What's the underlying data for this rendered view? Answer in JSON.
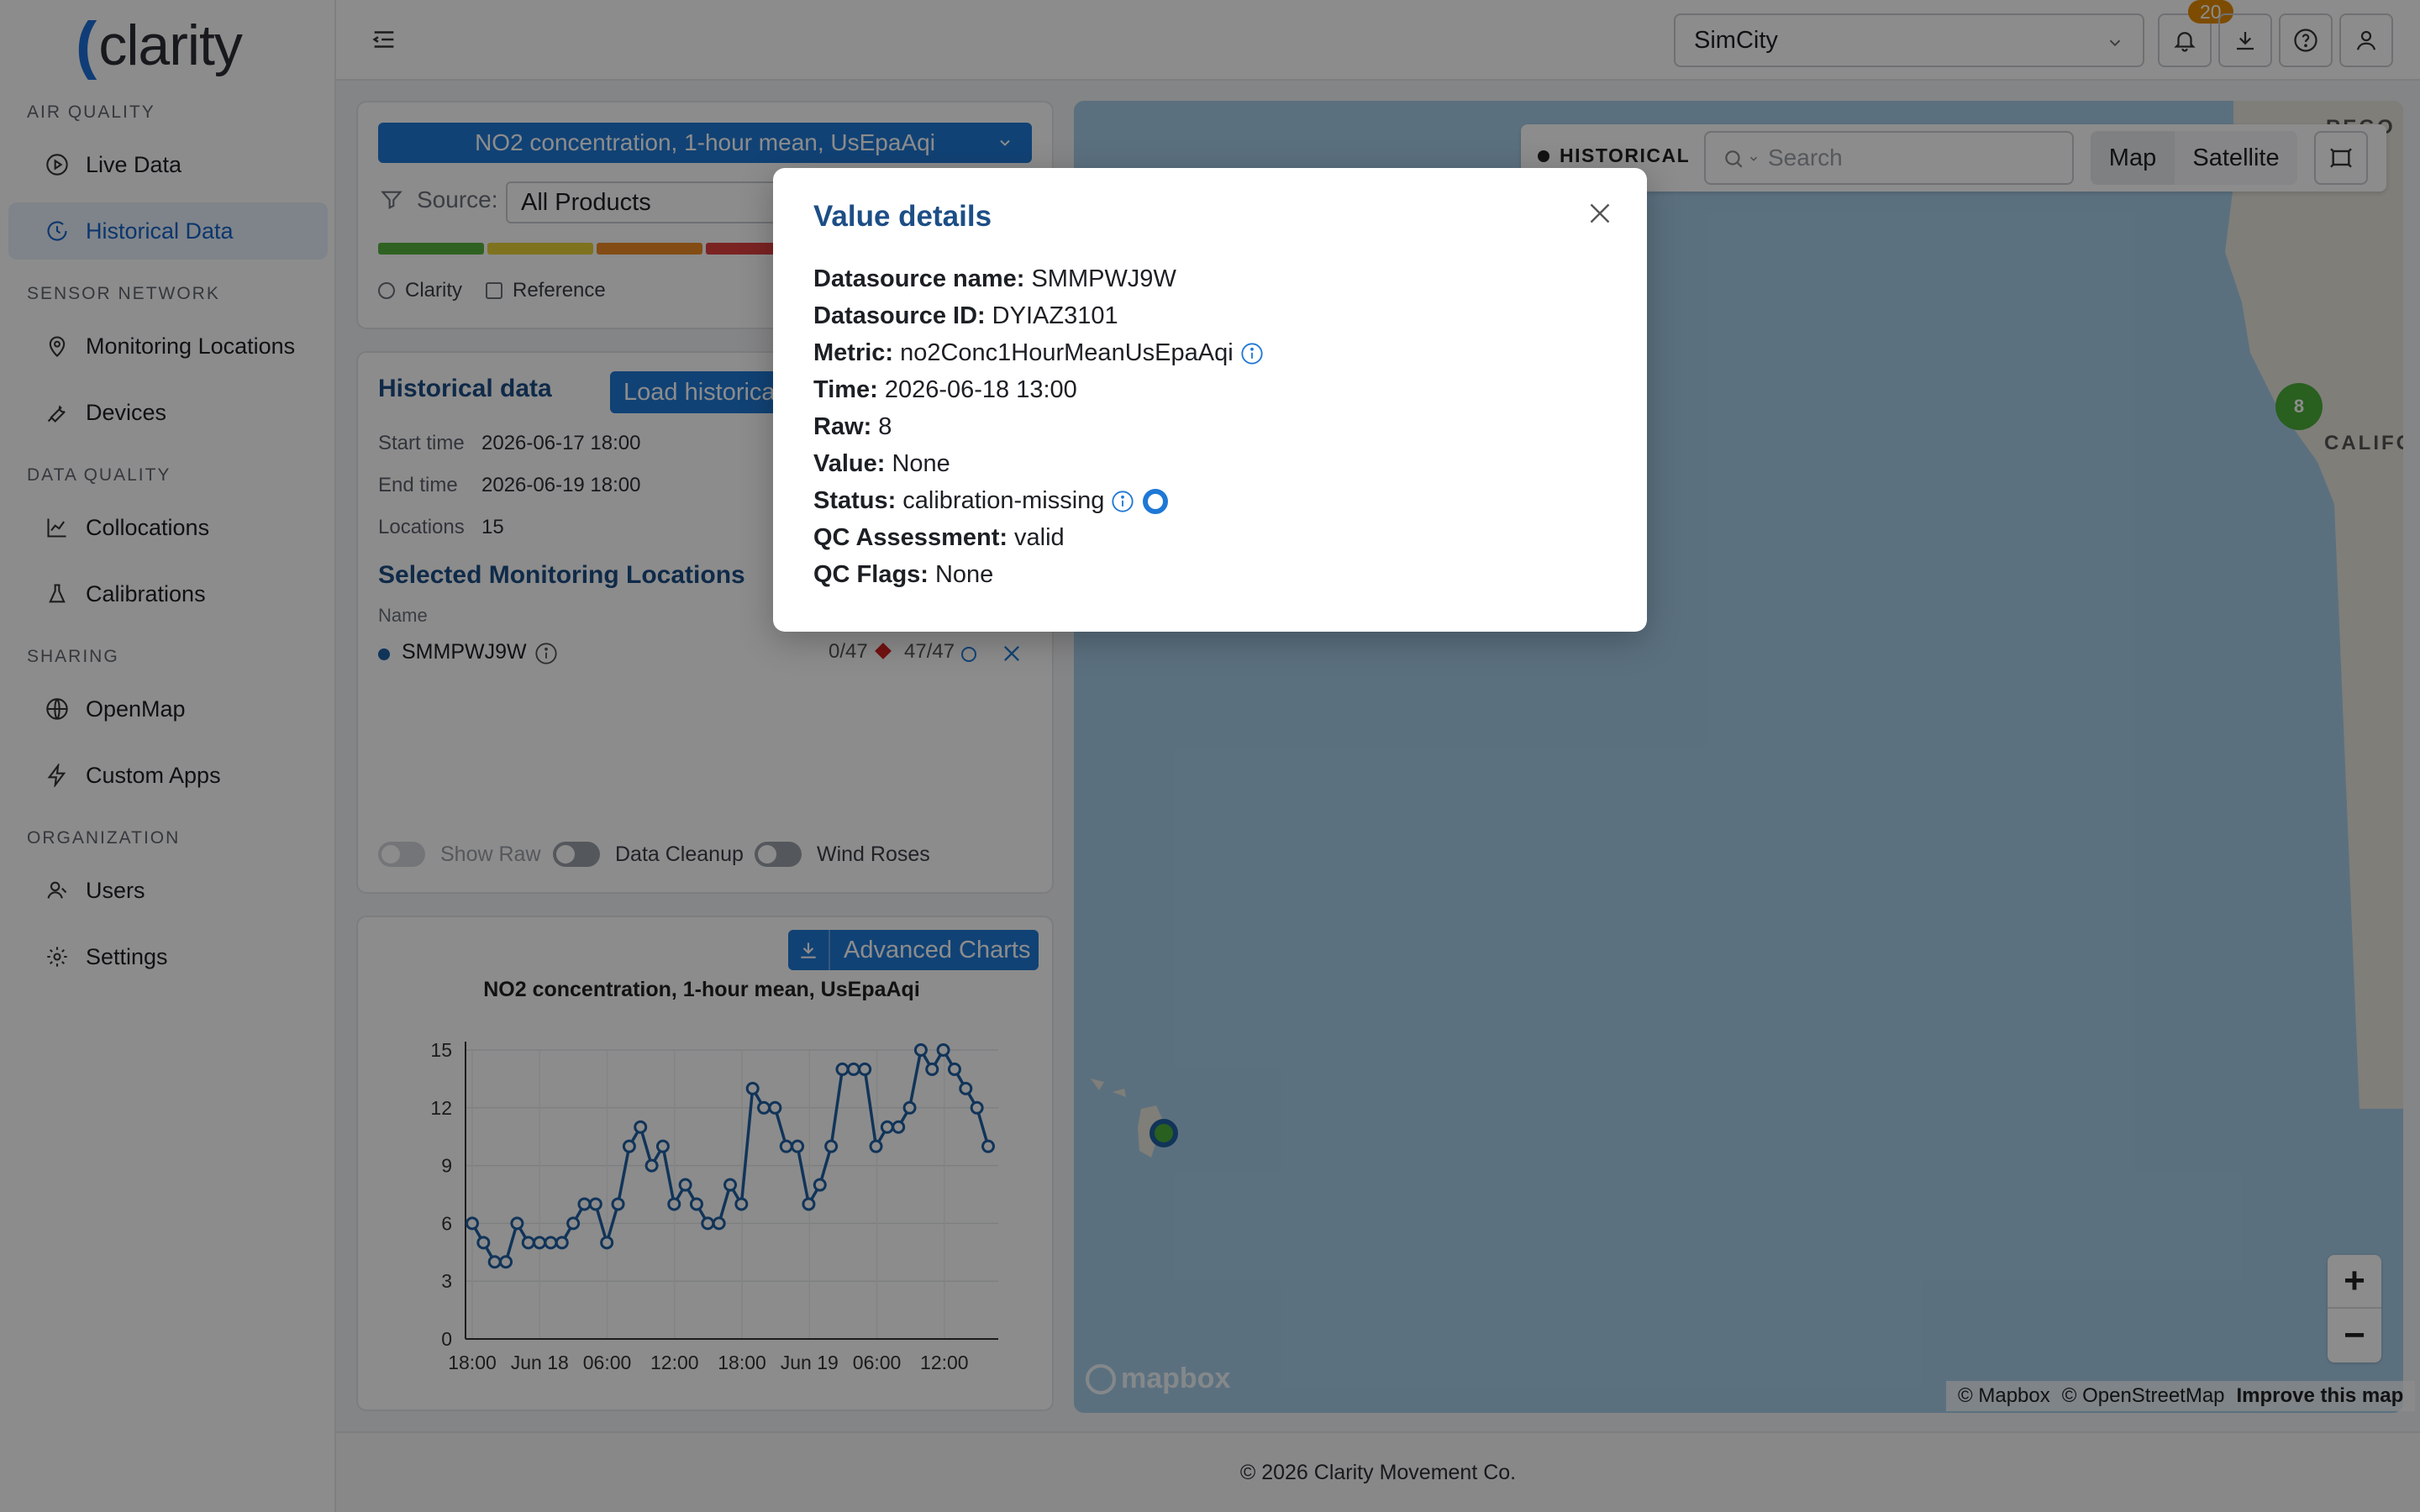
{
  "app": {
    "logo_mark": "(",
    "logo_text": "clarity"
  },
  "sidebar": {
    "sections": [
      {
        "label": "AIR QUALITY",
        "items": [
          {
            "label": "Live Data",
            "icon": "play-circle-icon"
          },
          {
            "label": "Historical Data",
            "icon": "clock-icon",
            "active": true
          }
        ]
      },
      {
        "label": "SENSOR NETWORK",
        "items": [
          {
            "label": "Monitoring Locations",
            "icon": "location-pin-icon"
          },
          {
            "label": "Devices",
            "icon": "wrench-icon"
          }
        ]
      },
      {
        "label": "DATA QUALITY",
        "items": [
          {
            "label": "Collocations",
            "icon": "line-chart-icon"
          },
          {
            "label": "Calibrations",
            "icon": "flask-icon"
          }
        ]
      },
      {
        "label": "SHARING",
        "items": [
          {
            "label": "OpenMap",
            "icon": "globe-icon"
          },
          {
            "label": "Custom Apps",
            "icon": "bolt-icon"
          }
        ]
      },
      {
        "label": "ORGANIZATION",
        "items": [
          {
            "label": "Users",
            "icon": "users-icon"
          },
          {
            "label": "Settings",
            "icon": "gear-icon"
          }
        ]
      }
    ]
  },
  "header": {
    "org": "SimCity",
    "notification_count": "20"
  },
  "filters": {
    "metric": "NO2 concentration, 1-hour mean, UsEpaAqi",
    "source_label": "Source:",
    "source_value": "All Products",
    "aq_colors": [
      "#56b23f",
      "#e7cf3a",
      "#ee8a26",
      "#e04040"
    ],
    "clarity_label": "Clarity",
    "reference_label": "Reference"
  },
  "historical": {
    "title": "Historical data",
    "load_button": "Load historical data",
    "start_label": "Start time",
    "start_value": "2026-06-17 18:00",
    "end_label": "End time",
    "end_value": "2026-06-19 18:00",
    "locations_label": "Locations",
    "locations_value": "15",
    "selected_title": "Selected Monitoring Locations",
    "name_header": "Name",
    "location": {
      "name": "SMMPWJ9W",
      "count_a": "0/47",
      "count_b": "47/47"
    },
    "toggles": {
      "show_raw": "Show Raw",
      "data_cleanup": "Data Cleanup",
      "wind_roses": "Wind Roses"
    }
  },
  "chart_panel": {
    "advanced_button": "Advanced Charts"
  },
  "chart_data": {
    "type": "line",
    "title": "NO2 concentration, 1-hour mean, UsEpaAqi",
    "xlabel": "",
    "ylabel": "",
    "ylim": [
      0,
      15
    ],
    "yticks": [
      0,
      3,
      6,
      9,
      12,
      15
    ],
    "xticks": [
      "18:00",
      "Jun 18",
      "06:00",
      "12:00",
      "18:00",
      "Jun 19",
      "06:00",
      "12:00"
    ],
    "series": [
      {
        "color": "#1f5fa3",
        "values": [
          6,
          5,
          4,
          4,
          6,
          5,
          5,
          5,
          5,
          6,
          7,
          7,
          5,
          7,
          10,
          11,
          9,
          10,
          7,
          8,
          7,
          6,
          6,
          8,
          7,
          13,
          12,
          12,
          10,
          10,
          7,
          8,
          10,
          14,
          14,
          14,
          10,
          11,
          11,
          12,
          15,
          14,
          15,
          14,
          13,
          12,
          10
        ]
      }
    ]
  },
  "map": {
    "mode_label": "HISTORICAL",
    "search_placeholder": "Search",
    "map_button": "Map",
    "satellite_button": "Satellite",
    "cluster_count": "8",
    "place_label": "CALIFO",
    "place_label_top": "REGO",
    "zoom_in": "+",
    "zoom_out": "−",
    "attribution_mapbox": "© Mapbox",
    "attribution_osm": "© OpenStreetMap",
    "improve": "Improve this map",
    "mapbox_logo": "mapbox"
  },
  "footer": {
    "text": "© 2026 Clarity Movement Co."
  },
  "modal": {
    "title": "Value details",
    "rows": [
      {
        "label": "Datasource name:",
        "value": "SMMPWJ9W"
      },
      {
        "label": "Datasource ID:",
        "value": "DYIAZ3101"
      },
      {
        "label": "Metric:",
        "value": "no2Conc1HourMeanUsEpaAqi"
      },
      {
        "label": "Time:",
        "value": "2026-06-18 13:00"
      },
      {
        "label": "Raw:",
        "value": "8"
      },
      {
        "label": "Value:",
        "value": "None"
      },
      {
        "label": "Status:",
        "value": "calibration-missing"
      },
      {
        "label": "QC Assessment:",
        "value": "valid"
      },
      {
        "label": "QC Flags:",
        "value": "None"
      }
    ]
  }
}
